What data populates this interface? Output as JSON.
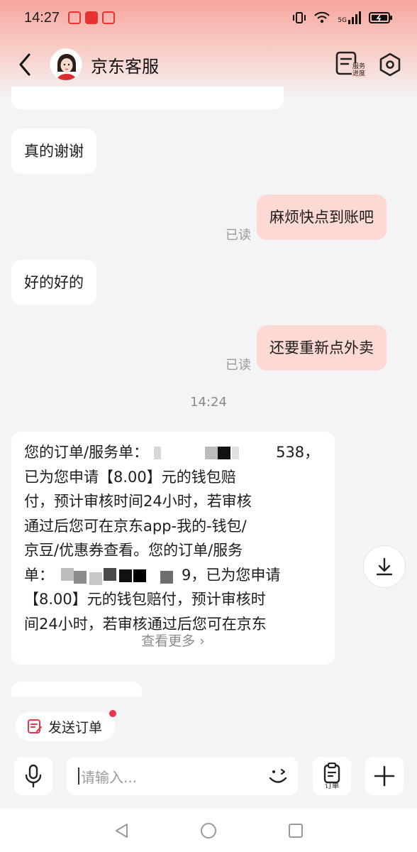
{
  "status_bar": {
    "time": "14:27",
    "network": "5G"
  },
  "header": {
    "title": "京东客服",
    "progress_label": "服务进度"
  },
  "messages": [
    {
      "side": "left",
      "text": "真的谢谢"
    },
    {
      "side": "right",
      "text": "麻烦快点到账吧",
      "status": "已读"
    },
    {
      "side": "left",
      "text": "好的好的"
    },
    {
      "side": "right",
      "text": "还要重新点外卖",
      "status": "已读"
    }
  ],
  "time_separator": "14:24",
  "long_message": {
    "lines": [
      "您的订单/服务单：",
      "已为您申请【8.00】元的钱包赔",
      "付，预计审核时间24小时，若审核",
      "通过后您可在京东app-我的-钱包/",
      "京豆/优惠券查看。您的订单/服务",
      "单：",
      "【8.00】元的钱包赔付，预计审核时",
      "间24小时，若审核通过后您可在京东"
    ],
    "order_tail_1": "538，",
    "order_tail_2": "9，已为您申请",
    "view_more": "查看更多 ›"
  },
  "send_order": {
    "label": "发送订单"
  },
  "input": {
    "placeholder": "请输入..."
  },
  "order_button": {
    "label": "订单"
  },
  "colors": {
    "accent": "#fcd9d3",
    "badge": "#e8364a",
    "header_gradient": "#f7a6a0"
  }
}
